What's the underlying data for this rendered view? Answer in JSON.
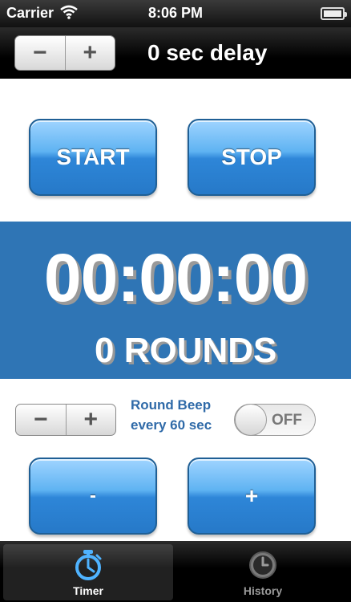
{
  "status_bar": {
    "carrier": "Carrier",
    "time": "8:06 PM"
  },
  "delay": {
    "minus_label": "−",
    "plus_label": "+",
    "label": "0  sec delay"
  },
  "controls": {
    "start_label": "START",
    "stop_label": "STOP"
  },
  "timer": {
    "display": "00:00:00",
    "rounds": "0 ROUNDS"
  },
  "round_beep": {
    "minus_label": "−",
    "plus_label": "+",
    "line1": "Round Beep",
    "line2": "every 60 sec",
    "toggle_state": "OFF"
  },
  "round_adjust": {
    "minus_label": "-",
    "plus_label": "+"
  },
  "tabs": [
    {
      "label": "Timer",
      "icon": "stopwatch-icon",
      "active": true
    },
    {
      "label": "History",
      "icon": "clock-icon",
      "active": false
    }
  ],
  "colors": {
    "accent_blue": "#2f75b5",
    "beep_text": "#2f6aa8"
  }
}
